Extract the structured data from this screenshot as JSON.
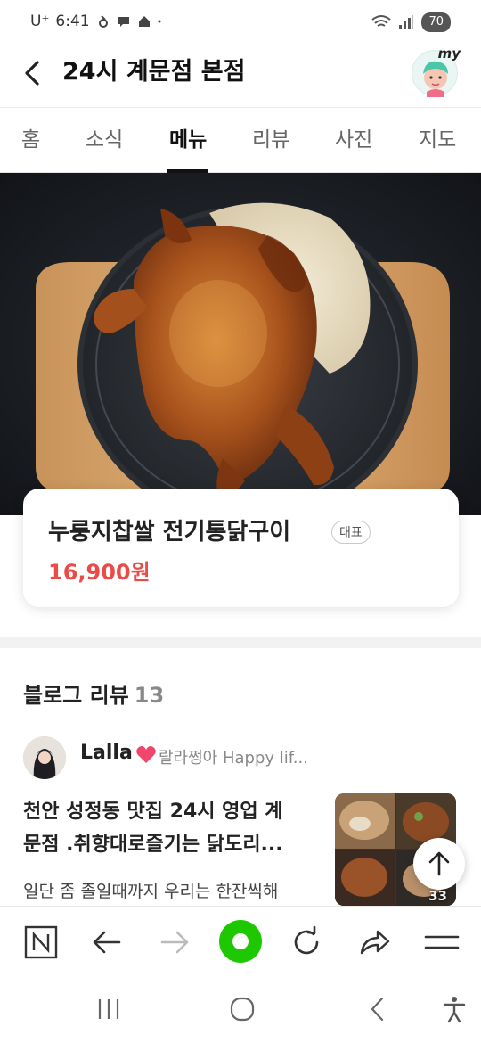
{
  "status_bar": {
    "carrier": "U⁺",
    "time": "6:41",
    "icons": [
      "wifi-icon",
      "signal-icon"
    ],
    "battery": "70"
  },
  "header": {
    "store_name": "24시 계문점 본점",
    "my_label": "my"
  },
  "tabs": [
    {
      "label": "홈"
    },
    {
      "label": "소식"
    },
    {
      "label": "메뉴",
      "active": true
    },
    {
      "label": "리뷰"
    },
    {
      "label": "사진"
    },
    {
      "label": "지도"
    }
  ],
  "menu_item": {
    "name": "누룽지찹쌀 전기통닭구이",
    "badge": "대표",
    "price": "16,900원"
  },
  "blog_reviews": {
    "title": "블로그 리뷰",
    "count": "13",
    "post": {
      "author_name": "Lalla",
      "author_blog": "랄라쩡아 Happy lif...",
      "title_line1": "천안 성정동 맛집 24시 영업 계",
      "title_line2": "문점 .취향대로즐기는 닭도리...",
      "snippet": "일단 좀 졸일때까지 우리는 한잔씩해",
      "photo_count": "33"
    }
  },
  "colors": {
    "accent_green": "#1ec800",
    "price_red": "#ea4b49"
  }
}
